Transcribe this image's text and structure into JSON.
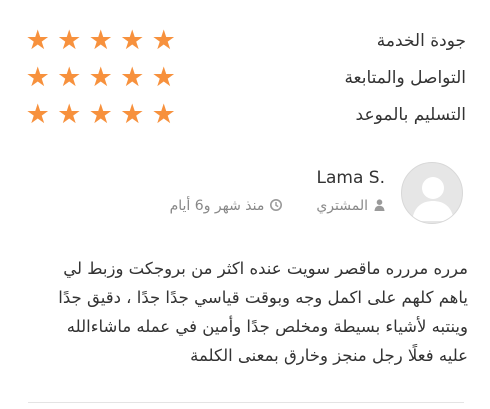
{
  "ratings": [
    {
      "label": "جودة الخدمة",
      "stars": 5
    },
    {
      "label": "التواصل والمتابعة",
      "stars": 5
    },
    {
      "label": "التسليم بالموعد",
      "stars": 5
    }
  ],
  "colors": {
    "star": "#f7913d",
    "text": "#333333",
    "meta": "#888888"
  },
  "reviewer": {
    "name": "Lama S.",
    "role": "المشتري",
    "time": "منذ شهر و6 أيام",
    "role_icon": "user-icon",
    "time_icon": "clock-icon"
  },
  "review": {
    "text": "مرره مررره ماقصر سويت عنده اكثر من بروجكت وزبط لي ياهم كلهم على اكمل وجه وبوقت قياسي جدًا جدًا ، دقيق جدًا وينتبه لأشياء بسيطة ومخلص جدًا وأمين في عمله ماشاءالله عليه فعلًا رجل منجز وخارق بمعنى الكلمة"
  }
}
